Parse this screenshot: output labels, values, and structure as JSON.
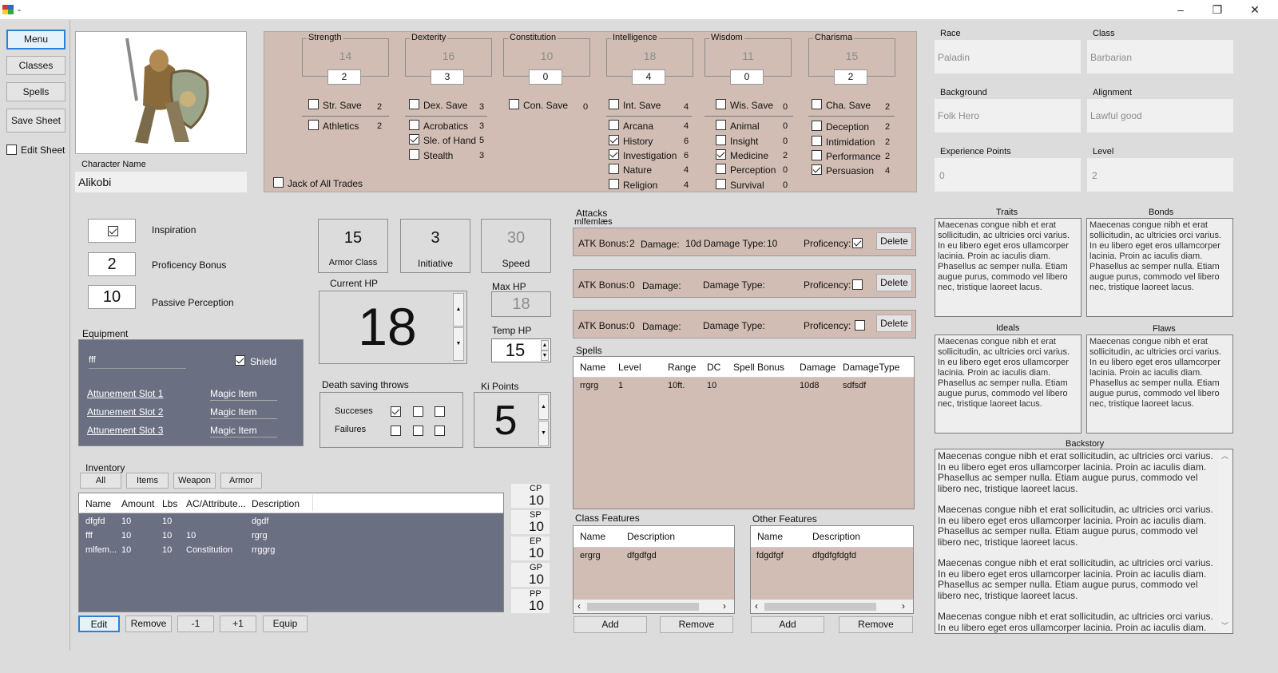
{
  "window": {
    "title": "-",
    "minimize": "–",
    "restore": "❐",
    "close": "✕"
  },
  "nav": {
    "menu": "Menu",
    "classes": "Classes",
    "spells": "Spells",
    "save_sheet": "Save Sheet",
    "edit_sheet": "Edit Sheet"
  },
  "character": {
    "name_label": "Character Name",
    "name": "Alikobi"
  },
  "abilities": [
    {
      "name": "Strength",
      "score": "14",
      "mod": "2"
    },
    {
      "name": "Dexterity",
      "score": "16",
      "mod": "3"
    },
    {
      "name": "Constitution",
      "score": "10",
      "mod": "0"
    },
    {
      "name": "Intelligence",
      "score": "18",
      "mod": "4"
    },
    {
      "name": "Wisdom",
      "score": "11",
      "mod": "0"
    },
    {
      "name": "Charisma",
      "score": "15",
      "mod": "2"
    }
  ],
  "saves": [
    {
      "label": "Str. Save",
      "value": "2",
      "checked": false
    },
    {
      "label": "Dex. Save",
      "value": "3",
      "checked": false
    },
    {
      "label": "Con. Save",
      "value": "0",
      "checked": false
    },
    {
      "label": "Int. Save",
      "value": "4",
      "checked": false
    },
    {
      "label": "Wis. Save",
      "value": "0",
      "checked": false
    },
    {
      "label": "Cha. Save",
      "value": "2",
      "checked": false
    }
  ],
  "skills": {
    "str": [
      {
        "label": "Athletics",
        "value": "2",
        "checked": false
      }
    ],
    "dex": [
      {
        "label": "Acrobatics",
        "value": "3",
        "checked": false
      },
      {
        "label": "Sle. of Hand",
        "value": "5",
        "checked": true
      },
      {
        "label": "Stealth",
        "value": "3",
        "checked": false
      }
    ],
    "int": [
      {
        "label": "Arcana",
        "value": "4",
        "checked": false
      },
      {
        "label": "History",
        "value": "6",
        "checked": true
      },
      {
        "label": "Investigation",
        "value": "6",
        "checked": true
      },
      {
        "label": "Nature",
        "value": "4",
        "checked": false
      },
      {
        "label": "Religion",
        "value": "4",
        "checked": false
      }
    ],
    "wis": [
      {
        "label": "Animal",
        "value": "0",
        "checked": false
      },
      {
        "label": "Insight",
        "value": "0",
        "checked": false
      },
      {
        "label": "Medicine",
        "value": "2",
        "checked": true
      },
      {
        "label": "Perception",
        "value": "0",
        "checked": false
      },
      {
        "label": "Survival",
        "value": "0",
        "checked": false
      }
    ],
    "cha": [
      {
        "label": "Deception",
        "value": "2",
        "checked": false
      },
      {
        "label": "Intimidation",
        "value": "2",
        "checked": false
      },
      {
        "label": "Performance",
        "value": "2",
        "checked": false
      },
      {
        "label": "Persuasion",
        "value": "4",
        "checked": true
      }
    ]
  },
  "jack_of_all_trades": "Jack of All Trades",
  "info": {
    "race_label": "Race",
    "race": "Paladin",
    "class_label": "Class",
    "class": "Barbarian",
    "background_label": "Background",
    "background": "Folk Hero",
    "alignment_label": "Alignment",
    "alignment": "Lawful good",
    "xp_label": "Experience Points",
    "xp": "0",
    "level_label": "Level",
    "level": "2"
  },
  "stats": {
    "inspiration_label": "Inspiration",
    "proficiency_value": "2",
    "proficiency_label": "Proficency Bonus",
    "passive_value": "10",
    "passive_label": "Passive Perception",
    "armor_class": "15",
    "armor_class_label": "Armor Class",
    "initiative": "3",
    "initiative_label": "Initiative",
    "speed": "30",
    "speed_label": "Speed",
    "current_hp_label": "Current HP",
    "current_hp": "18",
    "max_hp_label": "Max HP",
    "max_hp": "18",
    "temp_hp_label": "Temp HP",
    "temp_hp": "15",
    "ki_label": "Ki Points",
    "ki": "5"
  },
  "death_saves": {
    "title": "Death saving throws",
    "successes": "Succeses",
    "failures": "Failures"
  },
  "equipment": {
    "title": "Equipment",
    "main": "fff",
    "shield": "Shield",
    "slots": [
      {
        "label": "Attunement Slot 1",
        "item": "Magic Item"
      },
      {
        "label": "Attunement Slot 2",
        "item": "Magic Item"
      },
      {
        "label": "Attunement Slot 3",
        "item": "Magic Item"
      }
    ]
  },
  "inventory": {
    "title": "Inventory",
    "filters": [
      "All",
      "Items",
      "Weapon",
      "Armor"
    ],
    "columns": [
      "Name",
      "Amount",
      "Lbs",
      "AC/Attribute...",
      "Description"
    ],
    "rows": [
      [
        "dfgfd",
        "10",
        "10",
        "",
        "dgdf"
      ],
      [
        "fff",
        "10",
        "10",
        "10",
        "rgrg"
      ],
      [
        "mlfem...",
        "10",
        "10",
        "Constitution",
        "rrggrg"
      ]
    ],
    "actions": [
      "Edit",
      "Remove",
      "-1",
      "+1",
      "Equip"
    ]
  },
  "coins": [
    {
      "label": "CP",
      "value": "10"
    },
    {
      "label": "SP",
      "value": "10"
    },
    {
      "label": "EP",
      "value": "10"
    },
    {
      "label": "GP",
      "value": "10"
    },
    {
      "label": "PP",
      "value": "10"
    }
  ],
  "attacks": {
    "title": "Attacks",
    "subtitle": "mlfemlæs",
    "rows": [
      {
        "bonus": "ATK Bonus:",
        "bonus_val": "2",
        "damage": "Damage:",
        "damage_val": "10d",
        "type": "Damage Type:",
        "type_val": "10",
        "prof": "Proficency:",
        "checked": true,
        "delete": "Delete"
      },
      {
        "bonus": "ATK Bonus:",
        "bonus_val": "0",
        "damage": "Damage:",
        "damage_val": "",
        "type": "Damage Type:",
        "type_val": "",
        "prof": "Proficency:",
        "checked": false,
        "delete": "Delete"
      },
      {
        "bonus": "ATK Bonus:",
        "bonus_val": "0",
        "damage": "Damage:",
        "damage_val": "",
        "type": "Damage Type:",
        "type_val": "",
        "prof": "Proficency:",
        "checked": false,
        "delete": "Delete"
      }
    ]
  },
  "spells": {
    "title": "Spells",
    "columns": [
      "Name",
      "Level",
      "Range",
      "DC",
      "Spell Bonus",
      "Damage",
      "DamageType"
    ],
    "rows": [
      [
        "rrgrg",
        "1",
        "10ft.",
        "10",
        "",
        "10d8",
        "sdfsdf"
      ]
    ]
  },
  "class_features": {
    "title": "Class Features",
    "columns": [
      "Name",
      "Description"
    ],
    "rows": [
      [
        "ergrg",
        "dfgdfgd"
      ]
    ],
    "add": "Add",
    "remove": "Remove"
  },
  "other_features": {
    "title": "Other Features",
    "columns": [
      "Name",
      "Description"
    ],
    "rows": [
      [
        "fdgdfgf",
        "dfgdfgfdgfd"
      ]
    ],
    "add": "Add",
    "remove": "Remove"
  },
  "traits": {
    "title": "Traits",
    "text": "Maecenas congue nibh et erat sollicitudin, ac ultricies orci varius. In eu libero eget eros ullamcorper lacinia. Proin ac iaculis diam. Phasellus ac semper nulla. Etiam augue purus, commodo vel libero nec, tristique laoreet lacus."
  },
  "bonds": {
    "title": "Bonds",
    "text": "Maecenas congue nibh et erat sollicitudin, ac ultricies orci varius. In eu libero eget eros ullamcorper lacinia. Proin ac iaculis diam. Phasellus ac semper nulla. Etiam augue purus, commodo vel libero nec, tristique laoreet lacus."
  },
  "ideals": {
    "title": "Ideals",
    "text": "Maecenas congue nibh et erat sollicitudin, ac ultricies orci varius. In eu libero eget eros ullamcorper lacinia. Proin ac iaculis diam. Phasellus ac semper nulla. Etiam augue purus, commodo vel libero nec, tristique laoreet lacus."
  },
  "flaws": {
    "title": "Flaws",
    "text": "Maecenas congue nibh et erat sollicitudin, ac ultricies orci varius. In eu libero eget eros ullamcorper lacinia. Proin ac iaculis diam. Phasellus ac semper nulla. Etiam augue purus, commodo vel libero nec, tristique laoreet lacus."
  },
  "backstory": {
    "title": "Backstory",
    "paragraphs": [
      "Maecenas congue nibh et erat sollicitudin, ac ultricies orci varius. In eu libero eget eros ullamcorper lacinia. Proin ac iaculis diam. Phasellus ac semper nulla. Etiam augue purus, commodo vel libero nec, tristique laoreet lacus.",
      "Maecenas congue nibh et erat sollicitudin, ac ultricies orci varius. In eu libero eget eros ullamcorper lacinia. Proin ac iaculis diam. Phasellus ac semper nulla. Etiam augue purus, commodo vel libero nec, tristique laoreet lacus.",
      "Maecenas congue nibh et erat sollicitudin, ac ultricies orci varius. In eu libero eget eros ullamcorper lacinia. Proin ac iaculis diam. Phasellus ac semper nulla. Etiam augue purus, commodo vel libero nec, tristique laoreet lacus.",
      "Maecenas congue nibh et erat sollicitudin, ac ultricies orci varius. In eu libero eget eros ullamcorper lacinia. Proin ac iaculis diam. Phasellus ac"
    ]
  },
  "colors": {
    "accent": "#2f7fd5",
    "panel": "#d1bdb3",
    "equipment_bg": "#6b6f82",
    "background": "#dcdcdc"
  }
}
